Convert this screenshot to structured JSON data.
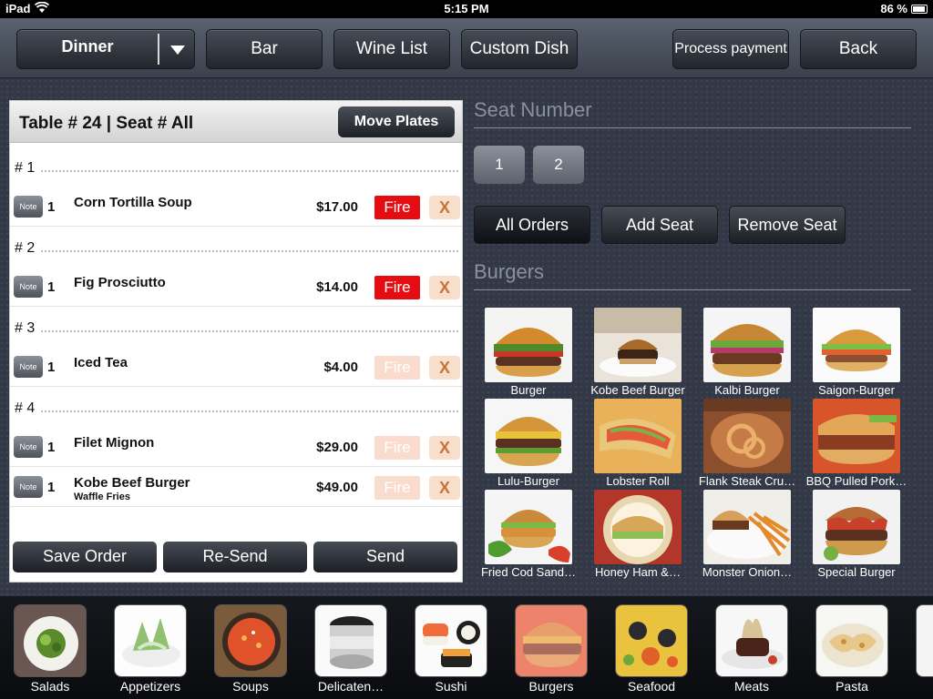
{
  "status_bar": {
    "carrier": "iPad",
    "time": "5:15 PM",
    "battery": "86 %"
  },
  "toolbar": {
    "menu_selector": "Dinner",
    "bar": "Bar",
    "wine_list": "Wine List",
    "custom_dish": "Custom Dish",
    "process_payment": "Process payment",
    "back": "Back"
  },
  "order": {
    "title": "Table # 24 | Seat # All",
    "move_plates": "Move Plates",
    "seats": [
      {
        "label": "# 1",
        "items": [
          {
            "note": "Note",
            "qty": "1",
            "name": "Corn Tortilla Soup",
            "sub": "",
            "price": "$17.00",
            "fire": "Fire",
            "fire_active": true,
            "remove": "X"
          }
        ]
      },
      {
        "label": "# 2",
        "items": [
          {
            "note": "Note",
            "qty": "1",
            "name": "Fig Prosciutto",
            "sub": "",
            "price": "$14.00",
            "fire": "Fire",
            "fire_active": true,
            "remove": "X"
          }
        ]
      },
      {
        "label": "# 3",
        "items": [
          {
            "note": "Note",
            "qty": "1",
            "name": "Iced Tea",
            "sub": "",
            "price": "$4.00",
            "fire": "Fire",
            "fire_active": false,
            "remove": "X"
          }
        ]
      },
      {
        "label": "# 4",
        "items": [
          {
            "note": "Note",
            "qty": "1",
            "name": "Filet Mignon",
            "sub": "",
            "price": "$29.00",
            "fire": "Fire",
            "fire_active": false,
            "remove": "X"
          },
          {
            "note": "Note",
            "qty": "1",
            "name": "Kobe Beef Burger",
            "sub": "Waffle Fries",
            "price": "$49.00",
            "fire": "Fire",
            "fire_active": false,
            "remove": "X"
          }
        ]
      }
    ],
    "save_order": "Save Order",
    "re_send": "Re-Send",
    "send": "Send"
  },
  "seat_section": {
    "title": "Seat Number",
    "seats": [
      "1",
      "2"
    ],
    "all_orders": "All Orders",
    "add_seat": "Add Seat",
    "remove_seat": "Remove Seat"
  },
  "menu_section": {
    "title": "Burgers",
    "items": [
      "Burger",
      "Kobe Beef Burger",
      "Kalbi Burger",
      "Saigon-Burger",
      "Lulu-Burger",
      "Lobster Roll",
      "Flank Steak Cru…",
      "BBQ Pulled Pork…",
      "Fried Cod Sand…",
      "Honey Ham &…",
      "Monster Onion…",
      "Special Burger"
    ]
  },
  "categories": {
    "items": [
      "Salads",
      "Appetizers",
      "Soups",
      "Delicaten…",
      "Sushi",
      "Burgers",
      "Seafood",
      "Meats",
      "Pasta"
    ],
    "selected": "Burgers"
  },
  "colors": {
    "fire_active": "#e50d12",
    "fire_inactive": "#f9dccd",
    "remove": "#f8dfcb",
    "section_title": "#8a919c"
  }
}
